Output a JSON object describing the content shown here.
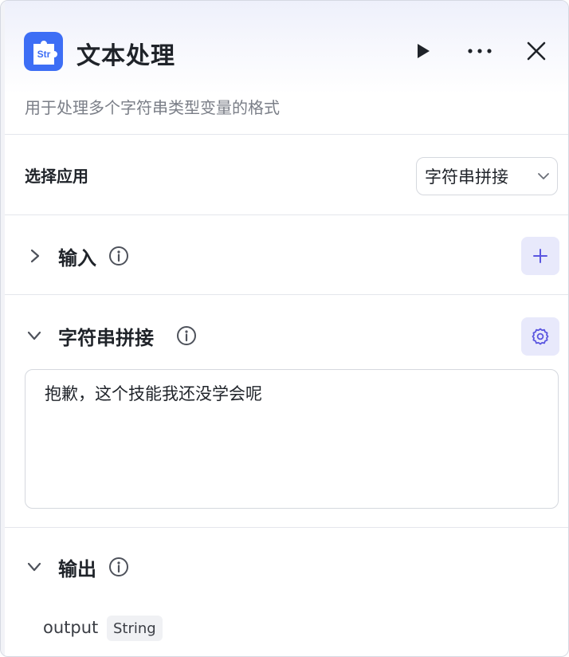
{
  "node": {
    "icon": "str-puzzle-icon",
    "icon_text": "Str",
    "title": "文本处理",
    "description": "用于处理多个字符串类型变量的格式"
  },
  "header_actions": [
    "play-icon",
    "more-icon",
    "close-icon"
  ],
  "app_select": {
    "label": "选择应用",
    "value": "字符串拼接"
  },
  "input_section": {
    "title": "输入",
    "expanded": false
  },
  "concat_section": {
    "title": "字符串拼接",
    "expanded": true,
    "content": "抱歉，这个技能我还没学会呢"
  },
  "output_section": {
    "title": "输出",
    "expanded": true,
    "items": [
      {
        "name": "output",
        "type": "String"
      }
    ]
  },
  "colors": {
    "accent": "#3d6ef5",
    "icon_button_bg": "#e8e9fb",
    "icon_button_fg": "#5a55e0"
  }
}
